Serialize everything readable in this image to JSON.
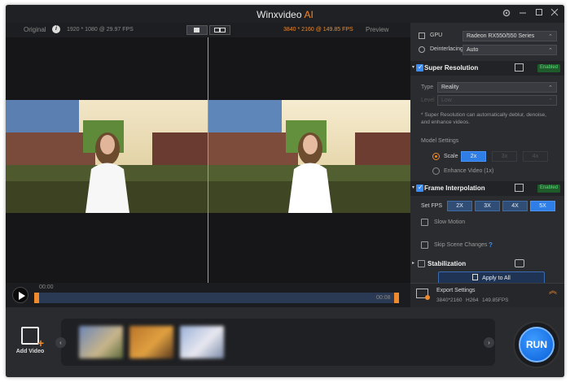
{
  "app": {
    "title": "Winxvideo",
    "title_accent": "AI",
    "settings_icon": "gear-icon",
    "min_icon": "minimize-icon",
    "max_icon": "maximize-icon",
    "close_icon": "close-icon"
  },
  "video_header": {
    "original_label": "Original",
    "original_info": "1920 * 1080 @ 29.97 FPS",
    "preview_info": "3840 * 2160 @ 149.85 FPS",
    "preview_label": "Preview"
  },
  "timeline": {
    "start_time": "00:00",
    "end_time": "00:08"
  },
  "bottom": {
    "add_video_label": "Add Video",
    "run_label": "RUN"
  },
  "panel": {
    "gpu_label": "GPU",
    "gpu_value": "Radeon RX550/550 Series",
    "deinterlacing_label": "Deinterlacing",
    "deinterlacing_value": "Auto",
    "super_resolution": {
      "title": "Super Resolution",
      "status": "Enabled",
      "type_label": "Type",
      "type_value": "Reality",
      "level_label": "Level",
      "level_value": "Low",
      "note": "* Super Resolution can automatically deblur, denoise, and enhance videos.",
      "model_settings_label": "Model Settings",
      "scale_label": "Scale",
      "scale_options": [
        "2x",
        "3x",
        "4x"
      ],
      "enhance_label": "Enhance Video (1x)"
    },
    "frame_interpolation": {
      "title": "Frame Interpolation",
      "status": "Enabled",
      "set_fps_label": "Set FPS",
      "fps_options": [
        "2X",
        "3X",
        "4X",
        "5X"
      ],
      "slow_motion_label": "Slow Motion",
      "skip_scene_label": "Skip Scene Changes",
      "help_glyph": "?"
    },
    "stabilization": {
      "title": "Stabilization",
      "apply_all_label": "Apply to All"
    }
  },
  "export": {
    "title": "Export Settings",
    "resolution": "3840*2160",
    "codec": "H264",
    "fps": "149.85FPS"
  },
  "colors": {
    "accent": "#f08a2c",
    "primary_blue": "#2f7de6",
    "enabled_green": "#5ce07a"
  }
}
